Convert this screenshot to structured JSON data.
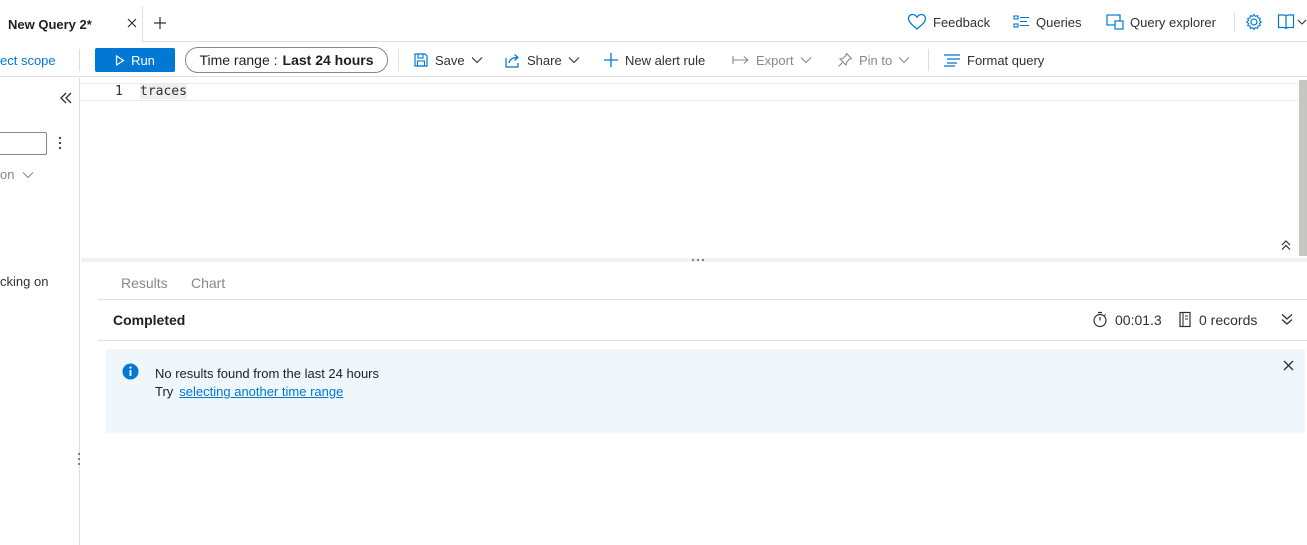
{
  "tab": {
    "title": "New Query 2*"
  },
  "header": {
    "feedback_label": "Feedback",
    "queries_label": "Queries",
    "query_explorer_label": "Query explorer"
  },
  "toolbar": {
    "scope_label": "ect scope",
    "run_label": "Run",
    "time_range_prefix": "Time range :",
    "time_range_value": "Last 24 hours",
    "save_label": "Save",
    "share_label": "Share",
    "new_alert_label": "New alert rule",
    "export_label": "Export",
    "pin_label": "Pin to",
    "format_label": "Format query"
  },
  "left_panel": {
    "dropdown_label": "on",
    "text": "cking on"
  },
  "editor": {
    "line_number": "1",
    "code": "traces"
  },
  "results": {
    "tabs": [
      "Results",
      "Chart"
    ],
    "status": "Completed",
    "duration": "00:01.3",
    "records": "0 records"
  },
  "message": {
    "line1": "No results found from the last 24 hours",
    "try_label": "Try",
    "link_label": "selecting another time range"
  },
  "colors": {
    "accent": "#0078d4",
    "info_background": "#eff6fc"
  }
}
